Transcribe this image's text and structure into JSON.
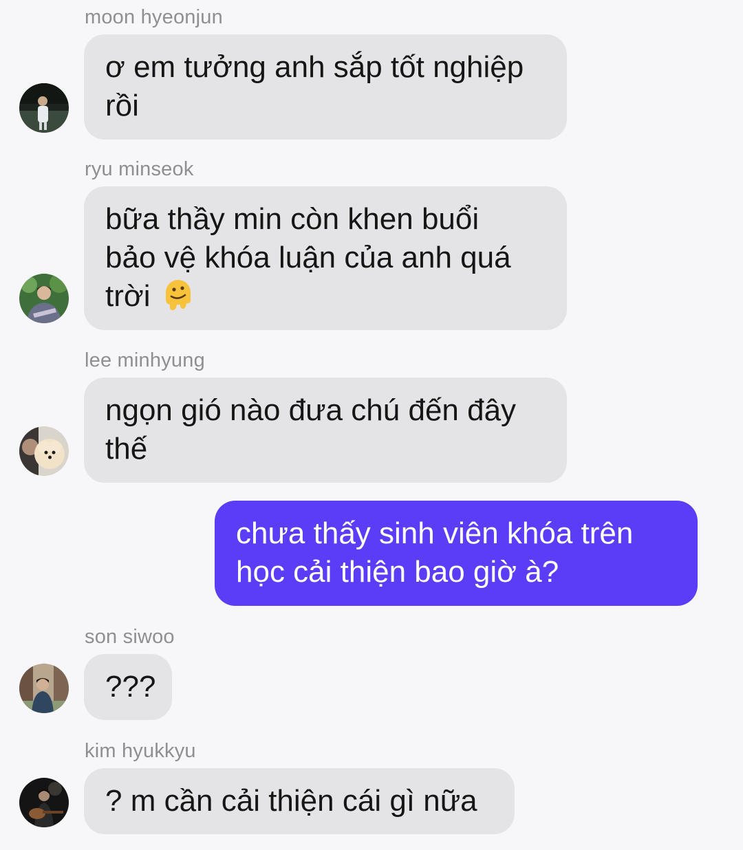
{
  "messages": [
    {
      "sender": "moon hyeonjun",
      "lines": [
        "ơ em tưởng anh sắp tốt nghiệp",
        "rồi"
      ],
      "avatar_icon": "person-outdoor-dark-avatar-icon"
    },
    {
      "sender": "ryu minseok",
      "lines": [
        "bữa thầy min còn khen buổi",
        "bảo vệ khóa luận của anh quá",
        "trời"
      ],
      "emoji": "melting-face-emoji",
      "avatar_icon": "person-green-background-avatar-icon"
    },
    {
      "sender": "lee minhyung",
      "lines": [
        "ngọn gió nào đưa chú đến đây",
        "thế"
      ],
      "avatar_icon": "person-with-pomeranian-avatar-icon"
    },
    {
      "outgoing": true,
      "lines": [
        "chưa thấy sinh viên khóa trên",
        "học cải thiện bao giờ à?"
      ]
    },
    {
      "sender": "son siwoo",
      "lines": [
        "???"
      ],
      "avatar_icon": "person-street-avatar-icon"
    },
    {
      "sender": "kim hyukkyu",
      "lines": [
        "? m cần cải thiện cái gì nữa"
      ],
      "avatar_icon": "person-with-guitar-avatar-icon"
    }
  ],
  "colors": {
    "background": "#f7f7f9",
    "incoming_bubble": "#e4e4e6",
    "outgoing_bubble": "#5b3cf7",
    "sender_text": "#8e8e93"
  }
}
